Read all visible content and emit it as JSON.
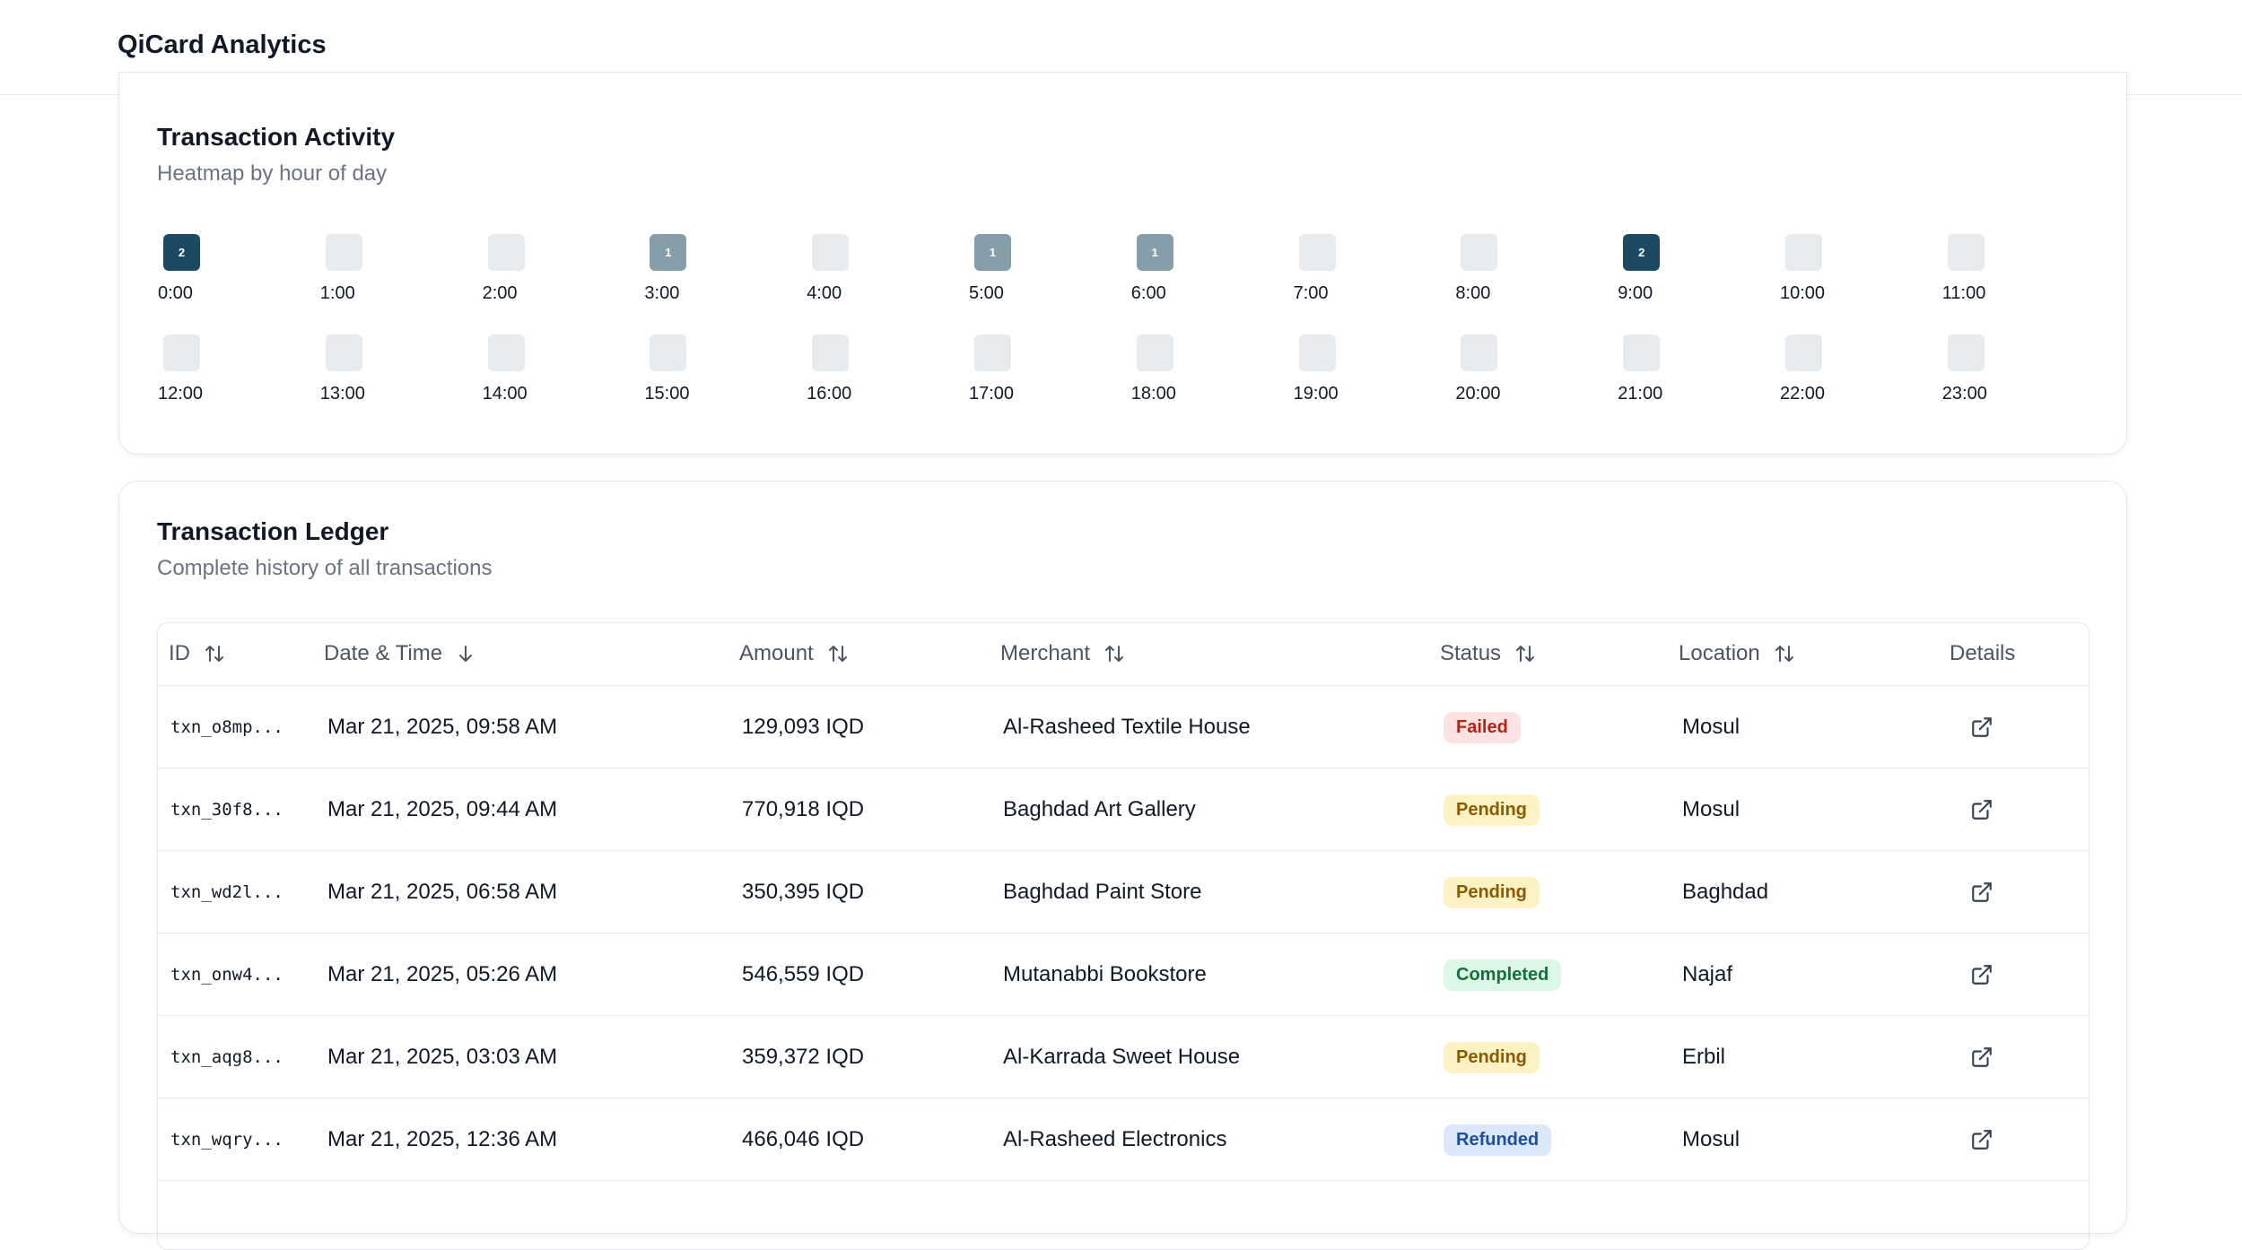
{
  "app": {
    "title": "QiCard Analytics"
  },
  "activity": {
    "title": "Transaction Activity",
    "subtitle": "Heatmap by hour of day",
    "hours": [
      {
        "label": "0:00",
        "count": 2
      },
      {
        "label": "1:00",
        "count": 0
      },
      {
        "label": "2:00",
        "count": 0
      },
      {
        "label": "3:00",
        "count": 1
      },
      {
        "label": "4:00",
        "count": 0
      },
      {
        "label": "5:00",
        "count": 1
      },
      {
        "label": "6:00",
        "count": 1
      },
      {
        "label": "7:00",
        "count": 0
      },
      {
        "label": "8:00",
        "count": 0
      },
      {
        "label": "9:00",
        "count": 2
      },
      {
        "label": "10:00",
        "count": 0
      },
      {
        "label": "11:00",
        "count": 0
      },
      {
        "label": "12:00",
        "count": 0
      },
      {
        "label": "13:00",
        "count": 0
      },
      {
        "label": "14:00",
        "count": 0
      },
      {
        "label": "15:00",
        "count": 0
      },
      {
        "label": "16:00",
        "count": 0
      },
      {
        "label": "17:00",
        "count": 0
      },
      {
        "label": "18:00",
        "count": 0
      },
      {
        "label": "19:00",
        "count": 0
      },
      {
        "label": "20:00",
        "count": 0
      },
      {
        "label": "21:00",
        "count": 0
      },
      {
        "label": "22:00",
        "count": 0
      },
      {
        "label": "23:00",
        "count": 0
      }
    ],
    "colors": {
      "empty": "#e8ebee",
      "low": "#869ea9",
      "high": "#1b4a62"
    }
  },
  "ledger": {
    "title": "Transaction Ledger",
    "subtitle": "Complete history of all transactions",
    "columns": [
      {
        "label": "ID",
        "sort": "both"
      },
      {
        "label": "Date & Time",
        "sort": "desc"
      },
      {
        "label": "Amount",
        "sort": "both"
      },
      {
        "label": "Merchant",
        "sort": "both"
      },
      {
        "label": "Status",
        "sort": "both"
      },
      {
        "label": "Location",
        "sort": "both"
      },
      {
        "label": "Details",
        "sort": "none"
      }
    ],
    "rows": [
      {
        "id": "txn_o8mp...",
        "datetime": "Mar 21, 2025, 09:58 AM",
        "amount": "129,093 IQD",
        "merchant": "Al-Rasheed Textile House",
        "status": "Failed",
        "location": "Mosul"
      },
      {
        "id": "txn_30f8...",
        "datetime": "Mar 21, 2025, 09:44 AM",
        "amount": "770,918 IQD",
        "merchant": "Baghdad Art Gallery",
        "status": "Pending",
        "location": "Mosul"
      },
      {
        "id": "txn_wd2l...",
        "datetime": "Mar 21, 2025, 06:58 AM",
        "amount": "350,395 IQD",
        "merchant": "Baghdad Paint Store",
        "status": "Pending",
        "location": "Baghdad"
      },
      {
        "id": "txn_onw4...",
        "datetime": "Mar 21, 2025, 05:26 AM",
        "amount": "546,559 IQD",
        "merchant": "Mutanabbi Bookstore",
        "status": "Completed",
        "location": "Najaf"
      },
      {
        "id": "txn_aqg8...",
        "datetime": "Mar 21, 2025, 03:03 AM",
        "amount": "359,372 IQD",
        "merchant": "Al-Karrada Sweet House",
        "status": "Pending",
        "location": "Erbil"
      },
      {
        "id": "txn_wqry...",
        "datetime": "Mar 21, 2025, 12:36 AM",
        "amount": "466,046 IQD",
        "merchant": "Al-Rasheed Electronics",
        "status": "Refunded",
        "location": "Mosul"
      }
    ],
    "details_icon": "external-link-icon"
  }
}
